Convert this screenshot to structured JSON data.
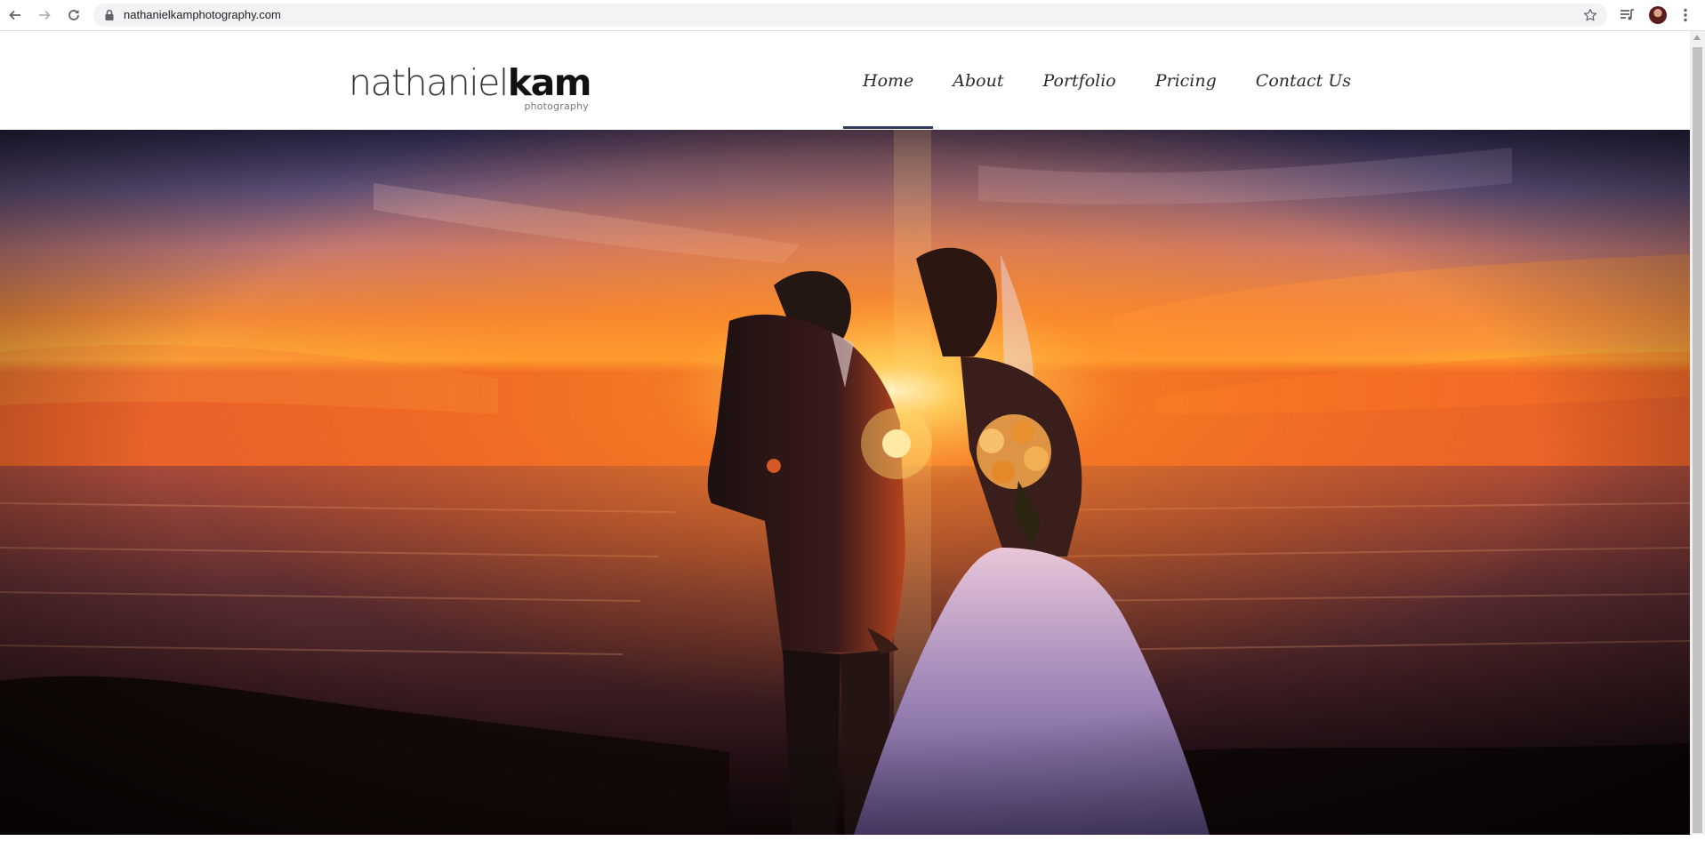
{
  "browser": {
    "url": "nathanielkamphotography.com",
    "icons": {
      "back": "arrow-left-icon",
      "forward": "arrow-right-icon",
      "reload": "reload-icon",
      "lock": "lock-icon",
      "bookmark": "star-icon",
      "media": "media-control-icon",
      "profile": "profile-avatar",
      "menu": "more-vert-icon"
    }
  },
  "logo": {
    "name_light": "nathaniel",
    "name_bold": "kam",
    "tagline": "photography"
  },
  "nav": {
    "items": [
      {
        "label": "Home",
        "active": true
      },
      {
        "label": "About",
        "active": false
      },
      {
        "label": "Portfolio",
        "active": false
      },
      {
        "label": "Pricing",
        "active": false
      },
      {
        "label": "Contact Us",
        "active": false
      }
    ]
  },
  "colors": {
    "nav_text": "#2c2c2c",
    "nav_active_underline": "#2f3a5c",
    "sky_top": "#3a3358",
    "horizon": "#ff9a2e",
    "sea": "#4a2a2a"
  }
}
